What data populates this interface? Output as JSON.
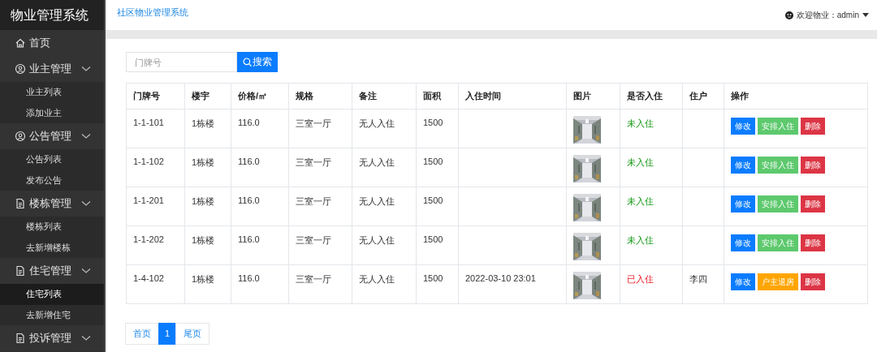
{
  "sidebar": {
    "title": "物业管理系统",
    "items": [
      {
        "kind": "home",
        "label": "首页"
      },
      {
        "kind": "people",
        "label": "业主管理",
        "children": [
          {
            "label": "业主列表",
            "selected": false
          },
          {
            "label": "添加业主",
            "selected": false
          }
        ]
      },
      {
        "kind": "people",
        "label": "公告管理",
        "children": [
          {
            "label": "公告列表",
            "selected": false
          },
          {
            "label": "发布公告",
            "selected": false
          }
        ]
      },
      {
        "kind": "document",
        "label": "楼栋管理",
        "children": [
          {
            "label": "楼栋列表",
            "selected": false
          },
          {
            "label": "去新增楼栋",
            "selected": false
          }
        ]
      },
      {
        "kind": "document",
        "label": "住宅管理",
        "children": [
          {
            "label": "住宅列表",
            "selected": true
          },
          {
            "label": "去新增住宅",
            "selected": false
          }
        ]
      },
      {
        "kind": "document",
        "label": "投诉管理"
      }
    ]
  },
  "header": {
    "breadcrumb": "社区物业管理系统",
    "user": "欢迎物业：admin"
  },
  "search": {
    "placeholder": "门牌号",
    "button": "搜索"
  },
  "table": {
    "columns": [
      "门牌号",
      "楼宇",
      "价格/㎡",
      "规格",
      "备注",
      "面积",
      "入住时间",
      "图片",
      "是否入住",
      "住户",
      "操作"
    ],
    "rows": [
      {
        "door": "1-1-101",
        "building": "1栋楼",
        "price": "116.0",
        "layout": "三室一厅",
        "note": "无人入住",
        "area": "1500",
        "time": "",
        "status": {
          "kind": "vacant",
          "label": "未入住"
        },
        "resident": "",
        "actions": [
          {
            "kind": "edit",
            "label": "修改"
          },
          {
            "kind": "checkin",
            "label": "安排入住"
          },
          {
            "kind": "delete",
            "label": "删除"
          }
        ]
      },
      {
        "door": "1-1-102",
        "building": "1栋楼",
        "price": "116.0",
        "layout": "三室一厅",
        "note": "无人入住",
        "area": "1500",
        "time": "",
        "status": {
          "kind": "vacant",
          "label": "未入住"
        },
        "resident": "",
        "actions": [
          {
            "kind": "edit",
            "label": "修改"
          },
          {
            "kind": "checkin",
            "label": "安排入住"
          },
          {
            "kind": "delete",
            "label": "删除"
          }
        ]
      },
      {
        "door": "1-1-201",
        "building": "1栋楼",
        "price": "116.0",
        "layout": "三室一厅",
        "note": "无人入住",
        "area": "1500",
        "time": "",
        "status": {
          "kind": "vacant",
          "label": "未入住"
        },
        "resident": "",
        "actions": [
          {
            "kind": "edit",
            "label": "修改"
          },
          {
            "kind": "checkin",
            "label": "安排入住"
          },
          {
            "kind": "delete",
            "label": "删除"
          }
        ]
      },
      {
        "door": "1-1-202",
        "building": "1栋楼",
        "price": "116.0",
        "layout": "三室一厅",
        "note": "无人入住",
        "area": "1500",
        "time": "",
        "status": {
          "kind": "vacant",
          "label": "未入住"
        },
        "resident": "",
        "actions": [
          {
            "kind": "edit",
            "label": "修改"
          },
          {
            "kind": "checkin",
            "label": "安排入住"
          },
          {
            "kind": "delete",
            "label": "删除"
          }
        ]
      },
      {
        "door": "1-4-102",
        "building": "1栋楼",
        "price": "116.0",
        "layout": "三室一厅",
        "note": "无人入住",
        "area": "1500",
        "time": "2022-03-10 23:01",
        "status": {
          "kind": "occupied",
          "label": "已入住"
        },
        "resident": "李四",
        "actions": [
          {
            "kind": "edit",
            "label": "修改"
          },
          {
            "kind": "checkout",
            "label": "户主退房"
          },
          {
            "kind": "delete",
            "label": "删除"
          }
        ]
      }
    ]
  },
  "pagination": [
    {
      "label": "首页",
      "selected": false
    },
    {
      "label": "1",
      "selected": true
    },
    {
      "label": "尾页",
      "selected": false
    }
  ]
}
